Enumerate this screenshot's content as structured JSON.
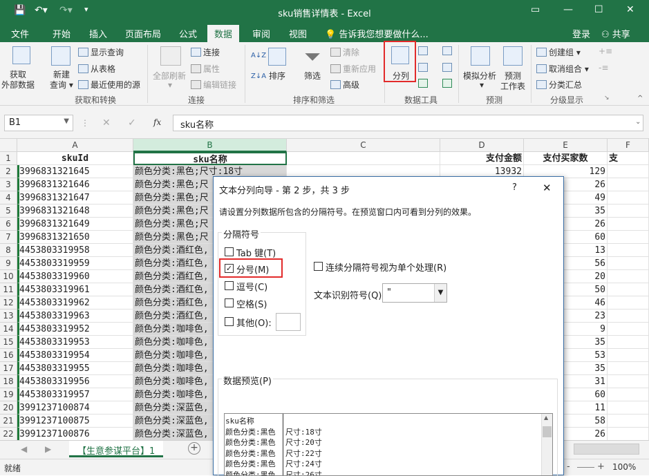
{
  "window": {
    "title": "sku销售详情表 - Excel",
    "ribbon_display_icon": "ribbon-display-icon",
    "minimize_icon": "minimize-icon",
    "maximize_icon": "maximize-icon",
    "close_icon": "close-icon"
  },
  "quick_access": {
    "save_icon": "save-icon",
    "undo_icon": "undo-icon",
    "redo_icon": "redo-icon",
    "customize_icon": "customize-icon"
  },
  "tabs": [
    "文件",
    "开始",
    "插入",
    "页面布局",
    "公式",
    "数据",
    "审阅",
    "视图"
  ],
  "active_tab": "数据",
  "tell_me": "告诉我您想要做什么...",
  "signin": "登录",
  "share": "共享",
  "ribbon": {
    "get_external": [
      "获取",
      "外部数据"
    ],
    "new_query": [
      "新建",
      "查询"
    ],
    "show_queries": "显示查询",
    "from_table": "从表格",
    "recent_sources": "最近使用的源",
    "group_get": "获取和转换",
    "refresh_all": "全部刷新",
    "connections": "连接",
    "properties": "属性",
    "edit_links": "编辑链接",
    "group_conn": "连接",
    "sort": "排序",
    "filter": "筛选",
    "clear": "清除",
    "reapply": "重新应用",
    "advanced": "高级",
    "group_sort": "排序和筛选",
    "text_to_columns": "分列",
    "group_tools": "数据工具",
    "what_if": "模拟分析",
    "forecast_sheet": [
      "预测",
      "工作表"
    ],
    "group_forecast": "预测",
    "group": "创建组",
    "ungroup": "取消组合",
    "subtotal": "分类汇总",
    "group_outline": "分级显示",
    "accent": "#217346",
    "highlight": "#e22a2a"
  },
  "formula_bar": {
    "name_box": "B1",
    "cancel": "✕",
    "enter": "✓",
    "fx": "fx",
    "value": "sku名称"
  },
  "grid": {
    "columns": [
      "A",
      "B",
      "C",
      "D",
      "E",
      "F"
    ],
    "header_row": {
      "row": "1",
      "A": "skuId",
      "B": "sku名称",
      "C": "",
      "D": "支付金额",
      "E": "支付买家数",
      "F": "支"
    },
    "rows": [
      {
        "row": "2",
        "A": "3996831321645",
        "B": "颜色分类:黑色;尺寸:18寸",
        "D": "13932",
        "E": "129"
      },
      {
        "row": "3",
        "A": "3996831321646",
        "B": "颜色分类:黑色;尺",
        "D": "",
        "E": "26"
      },
      {
        "row": "4",
        "A": "3996831321647",
        "B": "颜色分类:黑色;尺",
        "D": "",
        "E": "49"
      },
      {
        "row": "5",
        "A": "3996831321648",
        "B": "颜色分类:黑色;尺",
        "D": "",
        "E": "35"
      },
      {
        "row": "6",
        "A": "3996831321649",
        "B": "颜色分类:黑色;尺",
        "D": "",
        "E": "26"
      },
      {
        "row": "7",
        "A": "3996831321650",
        "B": "颜色分类:黑色;尺",
        "D": "",
        "E": "60"
      },
      {
        "row": "8",
        "A": "4453803319958",
        "B": "颜色分类:酒红色,",
        "D": "",
        "E": "13"
      },
      {
        "row": "9",
        "A": "4453803319959",
        "B": "颜色分类:酒红色,",
        "D": "",
        "E": "56"
      },
      {
        "row": "10",
        "A": "4453803319960",
        "B": "颜色分类:酒红色,",
        "D": "",
        "E": "20"
      },
      {
        "row": "11",
        "A": "4453803319961",
        "B": "颜色分类:酒红色,",
        "D": "",
        "E": "50"
      },
      {
        "row": "12",
        "A": "4453803319962",
        "B": "颜色分类:酒红色,",
        "D": "",
        "E": "46"
      },
      {
        "row": "13",
        "A": "4453803319963",
        "B": "颜色分类:酒红色,",
        "D": "",
        "E": "23"
      },
      {
        "row": "14",
        "A": "4453803319952",
        "B": "颜色分类:咖啡色,",
        "D": "",
        "E": "9"
      },
      {
        "row": "15",
        "A": "4453803319953",
        "B": "颜色分类:咖啡色,",
        "D": "",
        "E": "35"
      },
      {
        "row": "16",
        "A": "4453803319954",
        "B": "颜色分类:咖啡色,",
        "D": "",
        "E": "53"
      },
      {
        "row": "17",
        "A": "4453803319955",
        "B": "颜色分类:咖啡色,",
        "D": "",
        "E": "35"
      },
      {
        "row": "18",
        "A": "4453803319956",
        "B": "颜色分类:咖啡色,",
        "D": "",
        "E": "31"
      },
      {
        "row": "19",
        "A": "4453803319957",
        "B": "颜色分类:咖啡色,",
        "D": "",
        "E": "60"
      },
      {
        "row": "20",
        "A": "3991237100874",
        "B": "颜色分类:深蓝色,",
        "D": "",
        "E": "11"
      },
      {
        "row": "21",
        "A": "3991237100875",
        "B": "颜色分类:深蓝色,",
        "D": "",
        "E": "58"
      },
      {
        "row": "22",
        "A": "3991237100876",
        "B": "颜色分类:深蓝色,",
        "D": "",
        "E": "26"
      }
    ]
  },
  "sheet": {
    "tab": "【生意参谋平台】1",
    "add": "+"
  },
  "status": {
    "ready": "就绪",
    "zoom": "100%",
    "zoom_minus": "-",
    "zoom_plus": "+"
  },
  "dialog": {
    "title": "文本分列向导 - 第 2 步，共 3 步",
    "help": "?",
    "close": "✕",
    "instruction": "请设置分列数据所包含的分隔符号。在预览窗口内可看到分列的效果。",
    "delimiters_group": "分隔符号",
    "options": [
      {
        "label": "Tab 键(T)",
        "checked": false
      },
      {
        "label": "分号(M)",
        "checked": true
      },
      {
        "label": "逗号(C)",
        "checked": false
      },
      {
        "label": "空格(S)",
        "checked": false
      },
      {
        "label": "其他(O):",
        "checked": false
      }
    ],
    "consecutive": "连续分隔符号视为单个处理(R)",
    "qualifier_label": "文本识别符号(Q):",
    "qualifier_value": "\"",
    "preview_label": "数据预览(P)",
    "preview_rows": [
      [
        "sku名称",
        ""
      ],
      [
        "颜色分类:黑色",
        "尺寸:18寸"
      ],
      [
        "颜色分类:黑色",
        "尺寸:20寸"
      ],
      [
        "颜色分类:黑色",
        "尺寸:22寸"
      ],
      [
        "颜色分类:黑色",
        "尺寸:24寸"
      ],
      [
        "颜色分类:黑色",
        "尺寸:26寸"
      ]
    ]
  }
}
